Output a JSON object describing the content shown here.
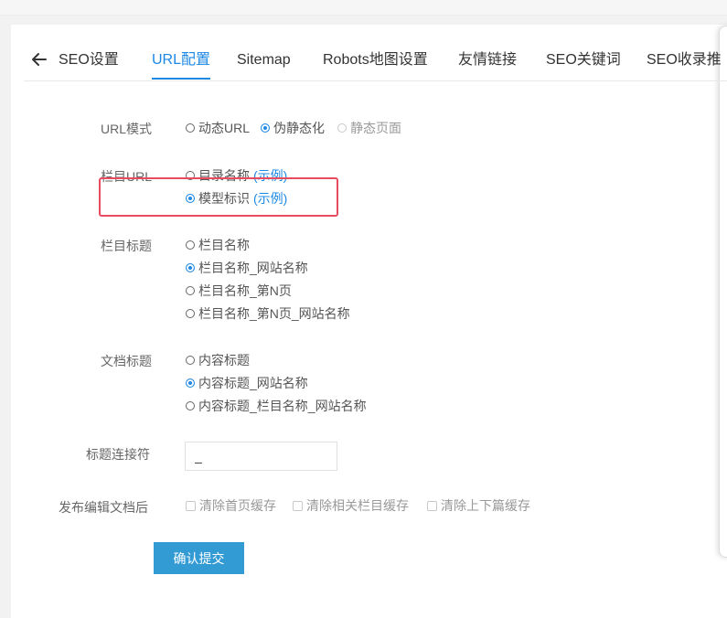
{
  "tabs": {
    "back_icon": "arrow-left-icon",
    "items": [
      {
        "label": "SEO设置"
      },
      {
        "label": "URL配置"
      },
      {
        "label": "Sitemap"
      },
      {
        "label": "Robots地图设置"
      },
      {
        "label": "友情链接"
      },
      {
        "label": "SEO关键词"
      },
      {
        "label": "SEO收录推"
      }
    ],
    "active": "URL配置"
  },
  "form": {
    "url_mode": {
      "label": "URL模式",
      "options": [
        "动态URL",
        "伪静态化",
        "静态页面"
      ],
      "selected": "伪静态化",
      "disabled": [
        "静态页面"
      ]
    },
    "column_url": {
      "label": "栏目URL",
      "options": [
        {
          "text": "目录名称",
          "example": "(示例)"
        },
        {
          "text": "模型标识",
          "example": "(示例)"
        }
      ],
      "selected": "模型标识"
    },
    "column_title": {
      "label": "栏目标题",
      "options": [
        "栏目名称",
        "栏目名称_网站名称",
        "栏目名称_第N页",
        "栏目名称_第N页_网站名称"
      ],
      "selected": "栏目名称_网站名称"
    },
    "doc_title": {
      "label": "文档标题",
      "options": [
        "内容标题",
        "内容标题_网站名称",
        "内容标题_栏目名称_网站名称"
      ],
      "selected": "内容标题_网站名称"
    },
    "title_connector": {
      "label": "标题连接符",
      "value": "_"
    },
    "after_publish": {
      "label": "发布编辑文档后",
      "options": [
        "清除首页缓存",
        "清除相关栏目缓存",
        "清除上下篇缓存"
      ]
    },
    "submit_label": "确认提交"
  },
  "colors": {
    "accent": "#1e88e5",
    "button": "#339bd3",
    "highlight": "#e84a5f"
  }
}
